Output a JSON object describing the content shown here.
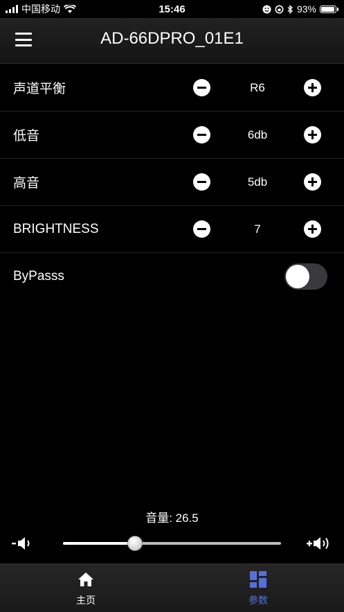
{
  "status_bar": {
    "carrier": "中国移动",
    "time": "15:46",
    "battery": "93%",
    "battery_level": 0.93
  },
  "header": {
    "title": "AD-66DPRO_01E1",
    "menu_icon": "hamburger-menu-icon"
  },
  "settings": [
    {
      "label": "声道平衡",
      "value": "R6"
    },
    {
      "label": "低音",
      "value": "6db"
    },
    {
      "label": "高音",
      "value": "5db"
    },
    {
      "label": "BRIGHTNESS",
      "value": "7"
    }
  ],
  "bypass": {
    "label": "ByPasss",
    "on": false
  },
  "volume": {
    "label": "音量: 26.5",
    "value": 26.5,
    "level": 0.33,
    "decrease_icon": "volume-down-icon",
    "increase_icon": "volume-up-icon"
  },
  "tabs": [
    {
      "label": "主页",
      "icon": "home-icon",
      "active": false
    },
    {
      "label": "参数",
      "icon": "grid-icon",
      "active": true
    }
  ],
  "colors": {
    "background": "#000000",
    "active_tab": "#5570d8",
    "inactive_tab": "#ffffff"
  }
}
